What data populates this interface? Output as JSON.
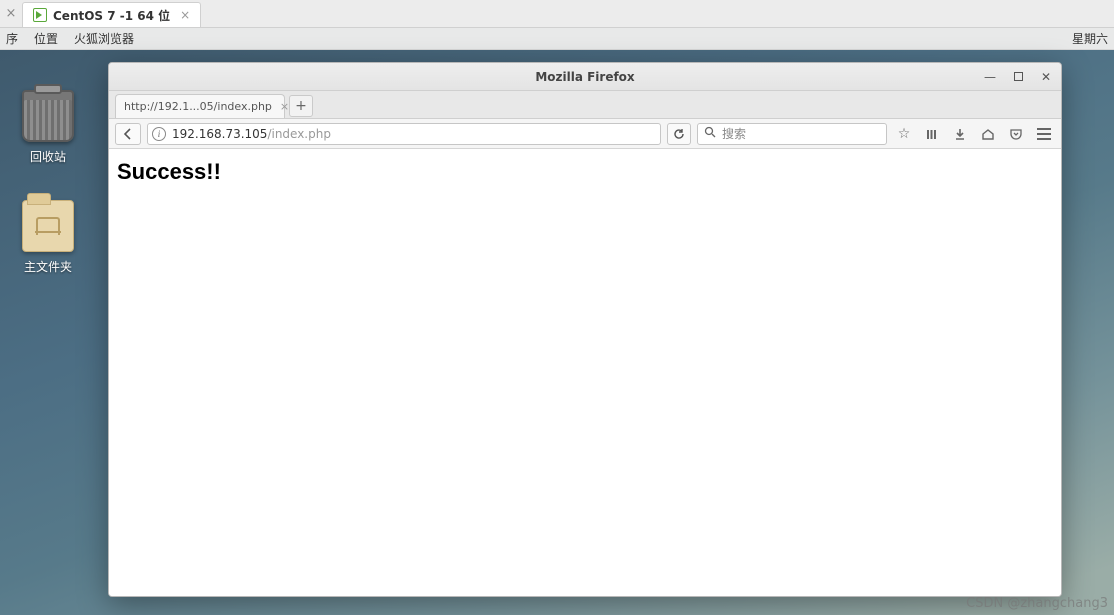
{
  "host": {
    "vm_tab_label": "CentOS 7 -1 64 位"
  },
  "guest_menubar": {
    "items": [
      "序",
      "位置",
      "火狐浏览器"
    ],
    "right_text": "星期六"
  },
  "desktop_icons": {
    "trash_label": "回收站",
    "home_label": "主文件夹"
  },
  "firefox": {
    "window_title": "Mozilla Firefox",
    "tab_label": "http://192.1...05/index.php",
    "url_host": "192.168.73.105",
    "url_path": "/index.php",
    "search_placeholder": "搜索",
    "page_heading": "Success!!"
  },
  "watermark": "CSDN @zhangchang3"
}
